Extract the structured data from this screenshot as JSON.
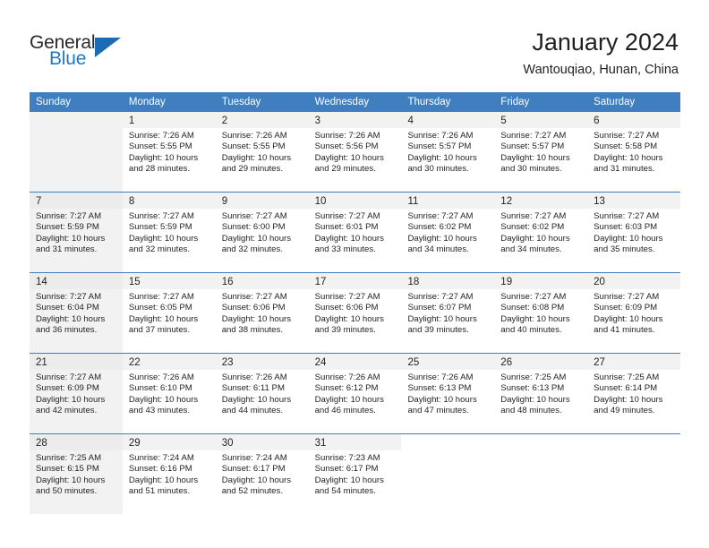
{
  "brand": {
    "name_part1": "General",
    "name_part2": "Blue",
    "triangle_color": "#1b6cb5",
    "blue_text_color": "#2079c4"
  },
  "header": {
    "title": "January 2024",
    "location": "Wantouqiao, Hunan, China"
  },
  "theme": {
    "header_blue": "#3f7fc0",
    "band_gray": "#f2f2f2"
  },
  "weekdays": [
    "Sunday",
    "Monday",
    "Tuesday",
    "Wednesday",
    "Thursday",
    "Friday",
    "Saturday"
  ],
  "weeks": [
    [
      {
        "day": "",
        "sunrise": "",
        "sunset": "",
        "daylight1": "",
        "daylight2": ""
      },
      {
        "day": "1",
        "sunrise": "Sunrise: 7:26 AM",
        "sunset": "Sunset: 5:55 PM",
        "daylight1": "Daylight: 10 hours",
        "daylight2": "and 28 minutes."
      },
      {
        "day": "2",
        "sunrise": "Sunrise: 7:26 AM",
        "sunset": "Sunset: 5:55 PM",
        "daylight1": "Daylight: 10 hours",
        "daylight2": "and 29 minutes."
      },
      {
        "day": "3",
        "sunrise": "Sunrise: 7:26 AM",
        "sunset": "Sunset: 5:56 PM",
        "daylight1": "Daylight: 10 hours",
        "daylight2": "and 29 minutes."
      },
      {
        "day": "4",
        "sunrise": "Sunrise: 7:26 AM",
        "sunset": "Sunset: 5:57 PM",
        "daylight1": "Daylight: 10 hours",
        "daylight2": "and 30 minutes."
      },
      {
        "day": "5",
        "sunrise": "Sunrise: 7:27 AM",
        "sunset": "Sunset: 5:57 PM",
        "daylight1": "Daylight: 10 hours",
        "daylight2": "and 30 minutes."
      },
      {
        "day": "6",
        "sunrise": "Sunrise: 7:27 AM",
        "sunset": "Sunset: 5:58 PM",
        "daylight1": "Daylight: 10 hours",
        "daylight2": "and 31 minutes."
      }
    ],
    [
      {
        "day": "7",
        "sunrise": "Sunrise: 7:27 AM",
        "sunset": "Sunset: 5:59 PM",
        "daylight1": "Daylight: 10 hours",
        "daylight2": "and 31 minutes."
      },
      {
        "day": "8",
        "sunrise": "Sunrise: 7:27 AM",
        "sunset": "Sunset: 5:59 PM",
        "daylight1": "Daylight: 10 hours",
        "daylight2": "and 32 minutes."
      },
      {
        "day": "9",
        "sunrise": "Sunrise: 7:27 AM",
        "sunset": "Sunset: 6:00 PM",
        "daylight1": "Daylight: 10 hours",
        "daylight2": "and 32 minutes."
      },
      {
        "day": "10",
        "sunrise": "Sunrise: 7:27 AM",
        "sunset": "Sunset: 6:01 PM",
        "daylight1": "Daylight: 10 hours",
        "daylight2": "and 33 minutes."
      },
      {
        "day": "11",
        "sunrise": "Sunrise: 7:27 AM",
        "sunset": "Sunset: 6:02 PM",
        "daylight1": "Daylight: 10 hours",
        "daylight2": "and 34 minutes."
      },
      {
        "day": "12",
        "sunrise": "Sunrise: 7:27 AM",
        "sunset": "Sunset: 6:02 PM",
        "daylight1": "Daylight: 10 hours",
        "daylight2": "and 34 minutes."
      },
      {
        "day": "13",
        "sunrise": "Sunrise: 7:27 AM",
        "sunset": "Sunset: 6:03 PM",
        "daylight1": "Daylight: 10 hours",
        "daylight2": "and 35 minutes."
      }
    ],
    [
      {
        "day": "14",
        "sunrise": "Sunrise: 7:27 AM",
        "sunset": "Sunset: 6:04 PM",
        "daylight1": "Daylight: 10 hours",
        "daylight2": "and 36 minutes."
      },
      {
        "day": "15",
        "sunrise": "Sunrise: 7:27 AM",
        "sunset": "Sunset: 6:05 PM",
        "daylight1": "Daylight: 10 hours",
        "daylight2": "and 37 minutes."
      },
      {
        "day": "16",
        "sunrise": "Sunrise: 7:27 AM",
        "sunset": "Sunset: 6:06 PM",
        "daylight1": "Daylight: 10 hours",
        "daylight2": "and 38 minutes."
      },
      {
        "day": "17",
        "sunrise": "Sunrise: 7:27 AM",
        "sunset": "Sunset: 6:06 PM",
        "daylight1": "Daylight: 10 hours",
        "daylight2": "and 39 minutes."
      },
      {
        "day": "18",
        "sunrise": "Sunrise: 7:27 AM",
        "sunset": "Sunset: 6:07 PM",
        "daylight1": "Daylight: 10 hours",
        "daylight2": "and 39 minutes."
      },
      {
        "day": "19",
        "sunrise": "Sunrise: 7:27 AM",
        "sunset": "Sunset: 6:08 PM",
        "daylight1": "Daylight: 10 hours",
        "daylight2": "and 40 minutes."
      },
      {
        "day": "20",
        "sunrise": "Sunrise: 7:27 AM",
        "sunset": "Sunset: 6:09 PM",
        "daylight1": "Daylight: 10 hours",
        "daylight2": "and 41 minutes."
      }
    ],
    [
      {
        "day": "21",
        "sunrise": "Sunrise: 7:27 AM",
        "sunset": "Sunset: 6:09 PM",
        "daylight1": "Daylight: 10 hours",
        "daylight2": "and 42 minutes."
      },
      {
        "day": "22",
        "sunrise": "Sunrise: 7:26 AM",
        "sunset": "Sunset: 6:10 PM",
        "daylight1": "Daylight: 10 hours",
        "daylight2": "and 43 minutes."
      },
      {
        "day": "23",
        "sunrise": "Sunrise: 7:26 AM",
        "sunset": "Sunset: 6:11 PM",
        "daylight1": "Daylight: 10 hours",
        "daylight2": "and 44 minutes."
      },
      {
        "day": "24",
        "sunrise": "Sunrise: 7:26 AM",
        "sunset": "Sunset: 6:12 PM",
        "daylight1": "Daylight: 10 hours",
        "daylight2": "and 46 minutes."
      },
      {
        "day": "25",
        "sunrise": "Sunrise: 7:26 AM",
        "sunset": "Sunset: 6:13 PM",
        "daylight1": "Daylight: 10 hours",
        "daylight2": "and 47 minutes."
      },
      {
        "day": "26",
        "sunrise": "Sunrise: 7:25 AM",
        "sunset": "Sunset: 6:13 PM",
        "daylight1": "Daylight: 10 hours",
        "daylight2": "and 48 minutes."
      },
      {
        "day": "27",
        "sunrise": "Sunrise: 7:25 AM",
        "sunset": "Sunset: 6:14 PM",
        "daylight1": "Daylight: 10 hours",
        "daylight2": "and 49 minutes."
      }
    ],
    [
      {
        "day": "28",
        "sunrise": "Sunrise: 7:25 AM",
        "sunset": "Sunset: 6:15 PM",
        "daylight1": "Daylight: 10 hours",
        "daylight2": "and 50 minutes."
      },
      {
        "day": "29",
        "sunrise": "Sunrise: 7:24 AM",
        "sunset": "Sunset: 6:16 PM",
        "daylight1": "Daylight: 10 hours",
        "daylight2": "and 51 minutes."
      },
      {
        "day": "30",
        "sunrise": "Sunrise: 7:24 AM",
        "sunset": "Sunset: 6:17 PM",
        "daylight1": "Daylight: 10 hours",
        "daylight2": "and 52 minutes."
      },
      {
        "day": "31",
        "sunrise": "Sunrise: 7:23 AM",
        "sunset": "Sunset: 6:17 PM",
        "daylight1": "Daylight: 10 hours",
        "daylight2": "and 54 minutes."
      },
      {
        "day": "",
        "sunrise": "",
        "sunset": "",
        "daylight1": "",
        "daylight2": ""
      },
      {
        "day": "",
        "sunrise": "",
        "sunset": "",
        "daylight1": "",
        "daylight2": ""
      },
      {
        "day": "",
        "sunrise": "",
        "sunset": "",
        "daylight1": "",
        "daylight2": ""
      }
    ]
  ]
}
